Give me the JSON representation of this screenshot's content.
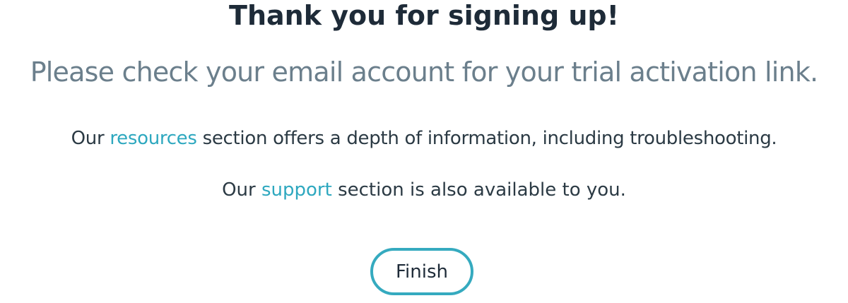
{
  "heading": "Thank you for signing up!",
  "subheading": "Please check your email account for your trial activation link.",
  "paragraph_1": {
    "prefix": "Our ",
    "link": "resources",
    "suffix": " section offers a depth of information, including troubleshooting."
  },
  "paragraph_2": {
    "prefix": "Our ",
    "link": "support",
    "suffix": " section is also available to you."
  },
  "finish_label": "Finish",
  "colors": {
    "heading": "#1e2b38",
    "subheading": "#6b7f8c",
    "link": "#2ea8bf",
    "button_border": "#35aabf"
  }
}
